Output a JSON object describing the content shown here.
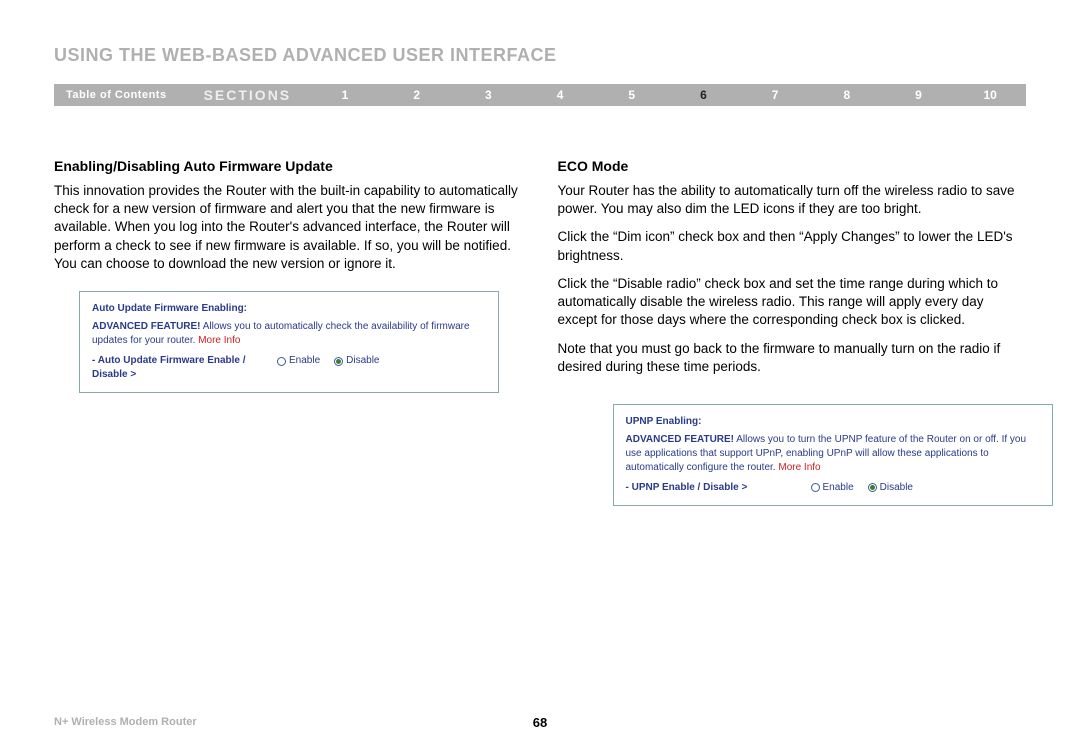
{
  "header": {
    "title": "USING THE WEB-BASED ADVANCED USER INTERFACE"
  },
  "nav": {
    "toc_label": "Table of Contents",
    "sections_label": "SECTIONS",
    "items": [
      "1",
      "2",
      "3",
      "4",
      "5",
      "6",
      "7",
      "8",
      "9",
      "10"
    ],
    "current": "6"
  },
  "left": {
    "heading": "Enabling/Disabling Auto Firmware Update",
    "body": "This innovation provides the Router with the built-in capability to automatically check for a new version of firmware and alert you that the new firmware is available. When you log into the Router's advanced interface, the Router will perform a check to see if new firmware is available. If so, you will be notified. You can choose to download the new version or ignore it.",
    "panel": {
      "title": "Auto Update Firmware Enabling:",
      "adv_label": "ADVANCED FEATURE!",
      "desc": "Allows you to automatically check the availability of firmware updates for your router.",
      "more": "More Info",
      "row_label": "- Auto Update Firmware Enable / Disable >",
      "enable": "Enable",
      "disable": "Disable",
      "selected": "disable"
    }
  },
  "right": {
    "heading": "ECO Mode",
    "p1": "Your Router has the ability to automatically turn off the wireless radio to save power. You may also dim the LED icons if they are too bright.",
    "p2": "Click the “Dim icon” check box and then “Apply Changes” to lower the LED's brightness.",
    "p3": "Click the “Disable radio” check box and set the time range during which to automatically disable the wireless radio. This range will apply every day except for those days where the corresponding check box is clicked.",
    "p4": "Note that you must go back to the firmware to manually turn on the radio if desired during these time periods.",
    "panel": {
      "title": "UPNP Enabling:",
      "adv_label": "ADVANCED FEATURE!",
      "desc": "Allows you to turn the UPNP feature of the Router on or off. If you use applications that support UPnP, enabling UPnP will allow these applications to automatically configure the router.",
      "more": "More Info",
      "row_label": "- UPNP Enable / Disable >",
      "enable": "Enable",
      "disable": "Disable",
      "selected": "disable"
    }
  },
  "footer": {
    "product": "N+ Wireless Modem Router",
    "page": "68"
  }
}
